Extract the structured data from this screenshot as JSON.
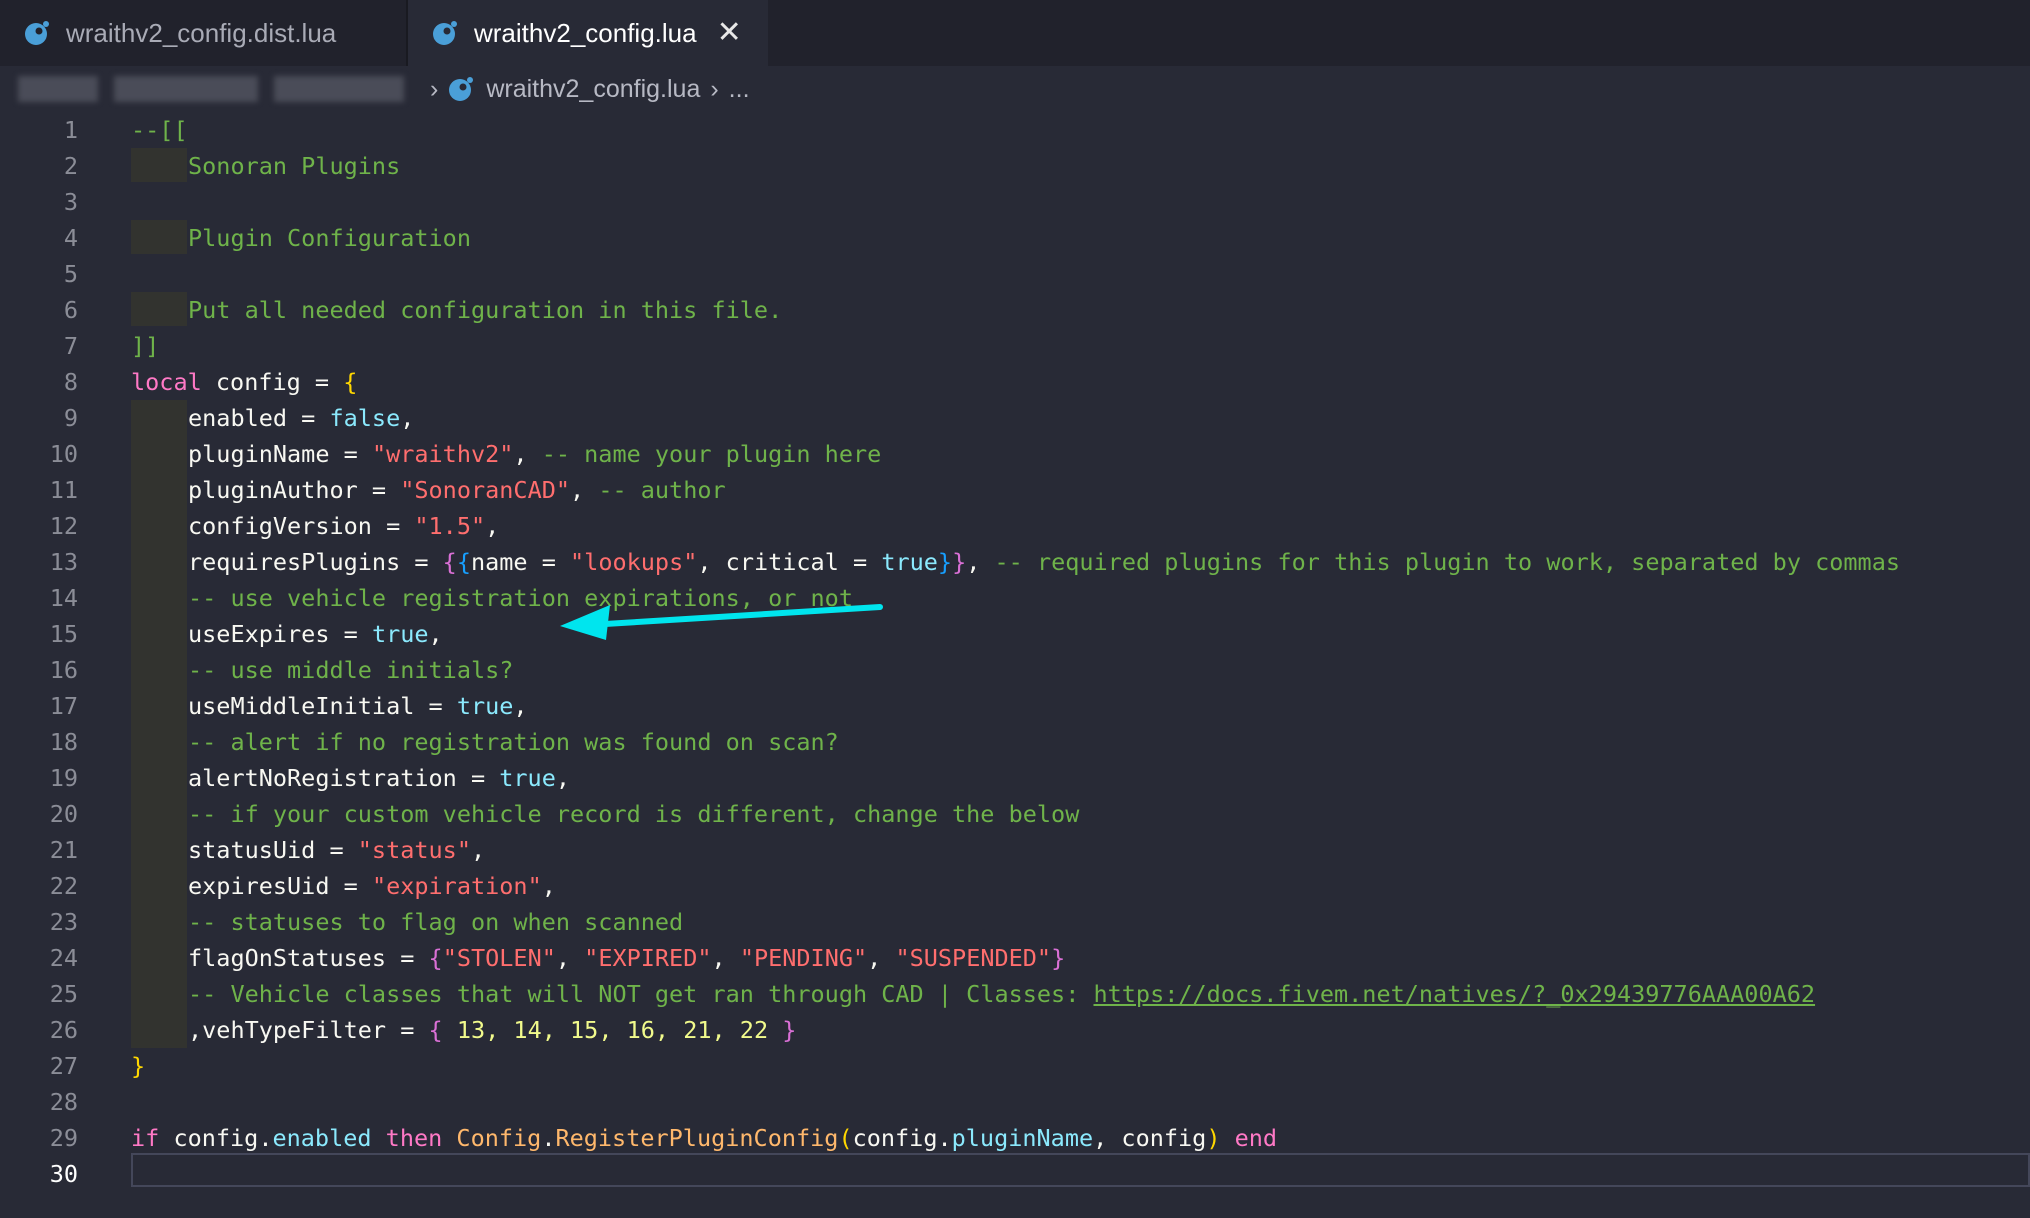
{
  "tabs": [
    {
      "label": "wraithv2_config.dist.lua",
      "active": false
    },
    {
      "label": "wraithv2_config.lua",
      "active": true
    }
  ],
  "breadcrumb": {
    "file": "wraithv2_config.lua",
    "ellipsis": "..."
  },
  "colors": {
    "accent_arrow": "#00e5ee",
    "comment": "#6fb34a",
    "keyword": "#ff79c6",
    "string": "#ff6e6e"
  },
  "editor": {
    "current_line": 30,
    "lines": [
      {
        "n": "1"
      },
      {
        "n": "2"
      },
      {
        "n": "3"
      },
      {
        "n": "4"
      },
      {
        "n": "5"
      },
      {
        "n": "6"
      },
      {
        "n": "7"
      },
      {
        "n": "8"
      },
      {
        "n": "9"
      },
      {
        "n": "10"
      },
      {
        "n": "11"
      },
      {
        "n": "12"
      },
      {
        "n": "13"
      },
      {
        "n": "14"
      },
      {
        "n": "15"
      },
      {
        "n": "16"
      },
      {
        "n": "17"
      },
      {
        "n": "18"
      },
      {
        "n": "19"
      },
      {
        "n": "20"
      },
      {
        "n": "21"
      },
      {
        "n": "22"
      },
      {
        "n": "23"
      },
      {
        "n": "24"
      },
      {
        "n": "25"
      },
      {
        "n": "26"
      },
      {
        "n": "27"
      },
      {
        "n": "28"
      },
      {
        "n": "29"
      },
      {
        "n": "30"
      }
    ],
    "code": {
      "l1": "--[[",
      "l2": "Sonoran Plugins",
      "l4": "Plugin Configuration",
      "l6": "Put all needed configuration in this file.",
      "l7": "]]",
      "l8_kw": "local",
      "l8_rest": " config = ",
      "l8_br": "{",
      "l9_key": "enabled = ",
      "l9_val": "false",
      "l9_end": ",",
      "l10_key": "pluginName = ",
      "l10_val": "\"wraithv2\"",
      "l10_sep": ", ",
      "l10_cm": "-- name your plugin here",
      "l11_key": "pluginAuthor = ",
      "l11_val": "\"SonoranCAD\"",
      "l11_sep": ", ",
      "l11_cm": "-- author",
      "l12_key": "configVersion = ",
      "l12_val": "\"1.5\"",
      "l12_end": ",",
      "l13_key": "requiresPlugins = ",
      "l13_b1": "{",
      "l13_b2": "{",
      "l13_name": "name = ",
      "l13_val": "\"lookups\"",
      "l13_crit": ", critical = ",
      "l13_true": "true",
      "l13_b3": "}",
      "l13_b4": "}",
      "l13_sep": ", ",
      "l13_cm": "-- required plugins for this plugin to work, separated by commas",
      "l14": "-- use vehicle registration expirations, or not",
      "l15_key": "useExpires = ",
      "l15_val": "true",
      "l15_end": ",",
      "l16": "-- use middle initials?",
      "l17_key": "useMiddleInitial = ",
      "l17_val": "true",
      "l17_end": ",",
      "l18": "-- alert if no registration was found on scan?",
      "l19_key": "alertNoRegistration = ",
      "l19_val": "true",
      "l19_end": ",",
      "l20": "-- if your custom vehicle record is different, change the below",
      "l21_key": "statusUid = ",
      "l21_val": "\"status\"",
      "l21_end": ",",
      "l22_key": "expiresUid = ",
      "l22_val": "\"expiration\"",
      "l22_end": ",",
      "l23": "-- statuses to flag on when scanned",
      "l24_key": "flagOnStatuses = ",
      "l24_b1": "{",
      "l24_s1": "\"STOLEN\"",
      "l24_c1": ", ",
      "l24_s2": "\"EXPIRED\"",
      "l24_c2": ", ",
      "l24_s3": "\"PENDING\"",
      "l24_c3": ", ",
      "l24_s4": "\"SUSPENDED\"",
      "l24_b2": "}",
      "l25_cm": "-- Vehicle classes that will NOT get ran through CAD | Classes: ",
      "l25_link": "https://docs.fivem.net/natives/?_0x29439776AAA00A62",
      "l26_key": ",vehTypeFilter = ",
      "l26_b1": "{",
      "l26_nums": " 13, 14, 15, 16, 21, 22 ",
      "l26_b2": "}",
      "l27": "}",
      "l29_if": "if",
      "l29_a": " config.",
      "l29_enabled": "enabled",
      "l29_then": " then ",
      "l29_Config": "Config",
      "l29_dot": ".",
      "l29_fn": "RegisterPluginConfig",
      "l29_p1": "(",
      "l29_b": "config.",
      "l29_pn": "pluginName",
      "l29_c": ", config",
      "l29_p2": ")",
      "l29_end": " end"
    }
  }
}
